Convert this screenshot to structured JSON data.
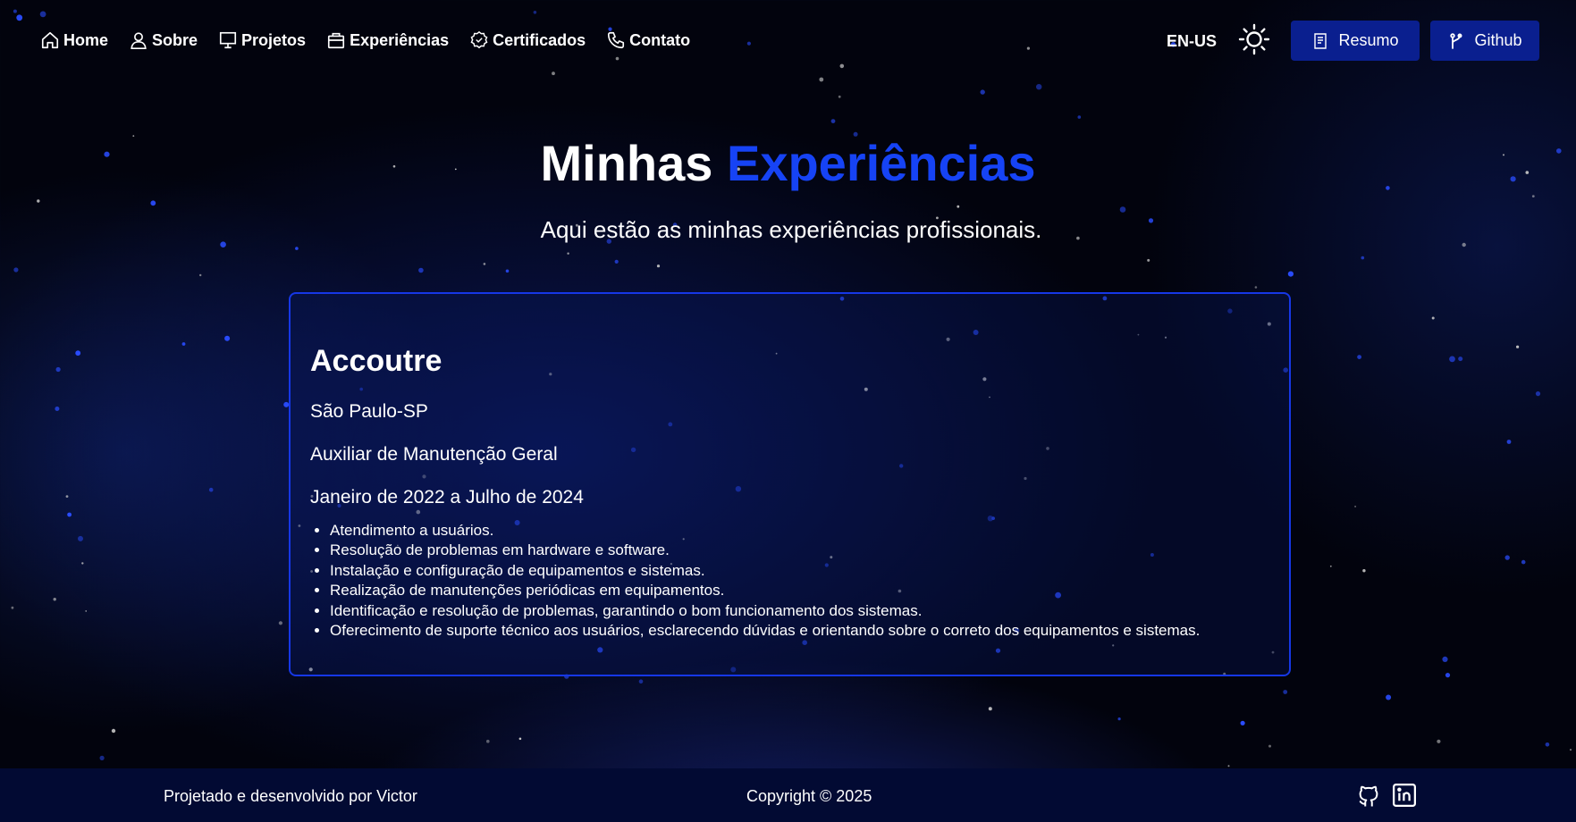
{
  "nav": {
    "links": [
      {
        "label": "Home",
        "icon": "home-icon"
      },
      {
        "label": "Sobre",
        "icon": "user-icon"
      },
      {
        "label": "Projetos",
        "icon": "monitor-icon"
      },
      {
        "label": "Experiências",
        "icon": "briefcase-icon"
      },
      {
        "label": "Certificados",
        "icon": "badge-icon"
      },
      {
        "label": "Contato",
        "icon": "phone-icon"
      }
    ],
    "language": "EN-US",
    "theme_icon": "sun-icon",
    "resume_label": "Resumo",
    "github_label": "Github"
  },
  "hero": {
    "title_plain": "Minhas",
    "title_accent": "Experiências",
    "subtitle": "Aqui estão as minhas experiências profissionais."
  },
  "experience": {
    "company": "Accoutre",
    "location": "São Paulo-SP",
    "role": "Auxiliar de Manutenção Geral",
    "period": "Janeiro de 2022 a Julho de 2024",
    "tasks": [
      "Atendimento a usuários.",
      "Resolução de problemas em hardware e software.",
      "Instalação e configuração de equipamentos e sistemas.",
      "Realização de manutenções periódicas em equipamentos.",
      "Identificação e resolução de problemas, garantindo o bom funcionamento dos sistemas.",
      "Oferecimento de suporte técnico aos usuários, esclarecendo dúvidas e orientando sobre o correto dos equipamentos e sistemas."
    ]
  },
  "footer": {
    "credit": "Projetado e desenvolvido por Victor",
    "copyright": "Copyright © 2025",
    "icons": [
      "github-icon",
      "linkedin-icon"
    ]
  },
  "colors": {
    "accent": "#1643f5",
    "button": "#0a1f8f",
    "card_border": "#1637e6",
    "footer_bg": "#020a33"
  }
}
